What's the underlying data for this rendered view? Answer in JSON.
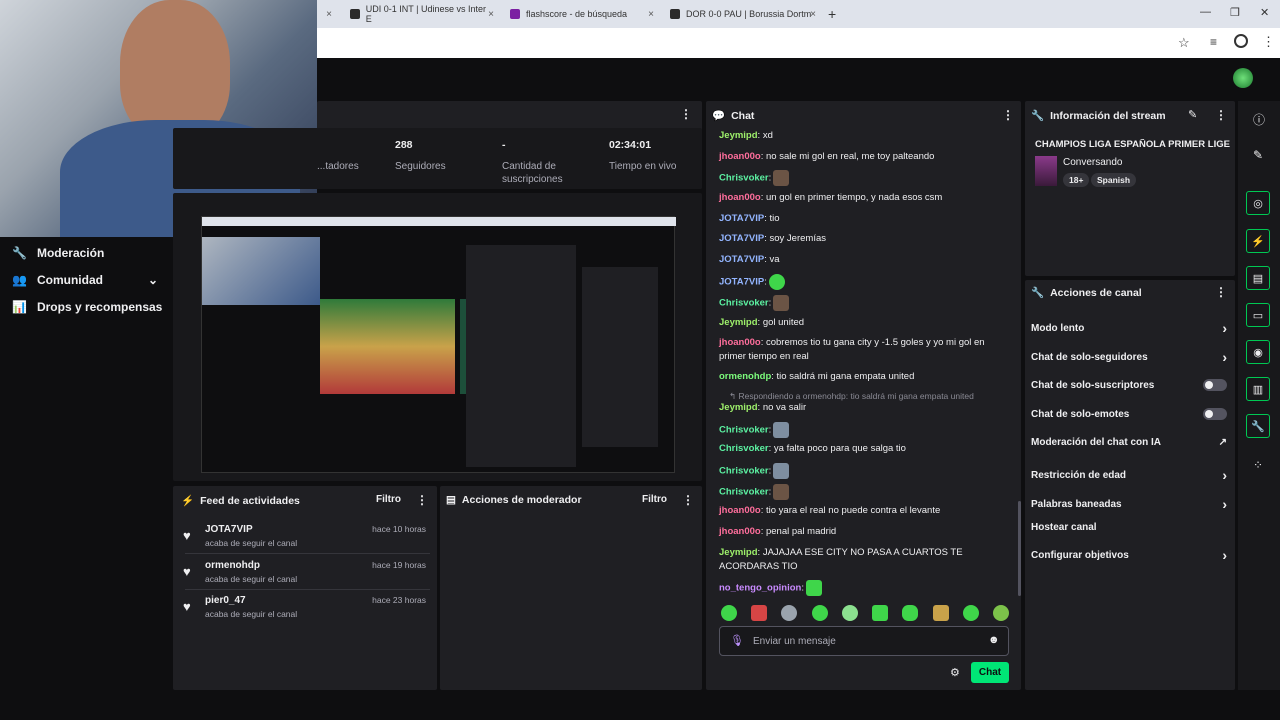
{
  "browser": {
    "tabs": [
      {
        "title": "UDI 0-1 INT | Udinese vs Inter E",
        "fav_color": "#2b2b2b"
      },
      {
        "title": "flashscore - de búsqueda",
        "fav_color": "#7b1fa2"
      },
      {
        "title": "DOR 0-0 PAU | Borussia Dortm",
        "fav_color": "#2b2b2b"
      }
    ],
    "new_tab": "+",
    "close_glyph": "×"
  },
  "nav": {
    "items": [
      {
        "label": "Moderación",
        "icon": "wrench-icon"
      },
      {
        "label": "Comunidad",
        "icon": "users-icon"
      },
      {
        "label": "Drops y recompensas",
        "icon": "chart-icon"
      }
    ]
  },
  "stats": [
    {
      "value": "",
      "label": "...tadores"
    },
    {
      "value": "288",
      "label": "Seguidores"
    },
    {
      "value": "-",
      "label": "Cantidad de suscripciones"
    },
    {
      "value": "02:34:01",
      "label": "Tiempo en vivo"
    }
  ],
  "feed": {
    "title": "Feed de actividades",
    "filter": "Filtro",
    "rows": [
      {
        "name": "JOTA7VIP",
        "sub": "acaba de seguir el canal",
        "time": "hace 10 horas"
      },
      {
        "name": "ormenohdp",
        "sub": "acaba de seguir el canal",
        "time": "hace 19 horas"
      },
      {
        "name": "pier0_47",
        "sub": "acaba de seguir el canal",
        "time": "hace 23 horas"
      }
    ]
  },
  "modactions": {
    "title": "Acciones de moderador",
    "filter": "Filtro"
  },
  "chat": {
    "title": "Chat",
    "messages": [
      {
        "user": "Jeymipd",
        "color": "#9ef06b",
        "text": ": xd"
      },
      {
        "user": "jhoan00o",
        "color": "#ff6e9c",
        "text": ": no sale mi gol en real, me toy palteando"
      },
      {
        "user": "Chrisvoker",
        "color": "#5cf2a2",
        "text": ":"
      },
      {
        "user": "jhoan00o",
        "color": "#ff6e9c",
        "text": ": un gol en primer tiempo, y nada esos csm"
      },
      {
        "user": "JOTA7VIP",
        "color": "#93b5ff",
        "text": ": tio"
      },
      {
        "user": "JOTA7VIP",
        "color": "#93b5ff",
        "text": ": soy Jeremías"
      },
      {
        "user": "JOTA7VIP",
        "color": "#93b5ff",
        "text": ": va"
      },
      {
        "user": "JOTA7VIP",
        "color": "#93b5ff",
        "text": ":"
      },
      {
        "user": "Chrisvoker",
        "color": "#5cf2a2",
        "text": ":"
      },
      {
        "user": "Jeymipd",
        "color": "#9ef06b",
        "text": ": gol united"
      },
      {
        "user": "jhoan00o",
        "color": "#ff6e9c",
        "text": ": cobremos tio tu gana city y -1.5 goles y yo mi gol en primer tiempo en real"
      },
      {
        "user": "ormenohdp",
        "color": "#7cfc7c",
        "text": ": tio saldrá mi gana empata united"
      },
      {
        "user": "Jeymipd",
        "color": "#9ef06b",
        "text": ": no va salir"
      },
      {
        "user": "Chrisvoker",
        "color": "#5cf2a2",
        "text": ":"
      },
      {
        "user": "Chrisvoker",
        "color": "#5cf2a2",
        "text": ": ya falta poco para que salga tio"
      },
      {
        "user": "Chrisvoker",
        "color": "#5cf2a2",
        "text": ":"
      },
      {
        "user": "Chrisvoker",
        "color": "#5cf2a2",
        "text": ":"
      },
      {
        "user": "jhoan00o",
        "color": "#ff6e9c",
        "text": ": tio yara el real no puede contra el levante"
      },
      {
        "user": "jhoan00o",
        "color": "#ff6e9c",
        "text": ": penal pal madrid"
      },
      {
        "user": "Jeymipd",
        "color": "#9ef06b",
        "text": ": JAJAJAA ESE CITY NO PASA A CUARTOS TE ACORDARAS TIO"
      },
      {
        "user": "no_tengo_opinion",
        "color": "#c98bff",
        "text": ":"
      }
    ],
    "reply_note": "Respondiendo a ormenohdp: tio saldrá mi gana empata united",
    "input_placeholder": "Enviar un mensaje",
    "send_label": "Chat"
  },
  "stream_info": {
    "title": "Información del stream",
    "stream_title": "CHAMPIOS LIGA ESPAÑOLA PRIMER LIGE",
    "category": "Conversando",
    "tags": [
      "18+",
      "Spanish"
    ]
  },
  "channel_actions": {
    "title": "Acciones de canal",
    "items": [
      {
        "label": "Modo lento",
        "kind": "arrow"
      },
      {
        "label": "Chat de solo-seguidores",
        "kind": "arrow"
      },
      {
        "label": "Chat de solo-suscriptores",
        "kind": "toggle"
      },
      {
        "label": "Chat de solo-emotes",
        "kind": "toggle"
      },
      {
        "label": "Moderación del chat con IA",
        "kind": "external"
      },
      {
        "label": "Restricción de edad",
        "kind": "arrow"
      },
      {
        "label": "Palabras baneadas",
        "kind": "arrow"
      },
      {
        "label": "Hostear canal",
        "kind": "none"
      },
      {
        "label": "Configurar objetivos",
        "kind": "arrow"
      }
    ]
  },
  "colors": {
    "accent": "#00e676",
    "panel": "#1f1f23",
    "bg": "#0e0e10"
  }
}
